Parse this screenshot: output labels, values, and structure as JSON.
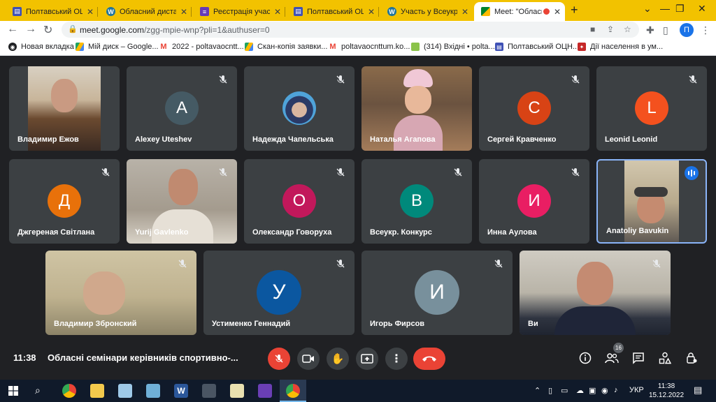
{
  "browser": {
    "tabs": [
      {
        "title": "Полтавський ОЦН",
        "active": false
      },
      {
        "title": "Обласний дистанц",
        "active": false
      },
      {
        "title": "Реєстрація учасни",
        "active": false
      },
      {
        "title": "Полтавський ОЦН",
        "active": false
      },
      {
        "title": "Участь у Всеукраїн",
        "active": false
      },
      {
        "title": "Meet: \"Обласн",
        "active": true
      }
    ],
    "new_tab": "+",
    "url_host": "meet.google.com",
    "url_path": "/zgg-mpie-wnp?pli=1&authuser=0",
    "profile_initial": "П",
    "bookmarks": [
      "Новая вкладка",
      "Мій диск – Google...",
      "2022 - poltavaocntt...",
      "Скан-копія заявки...",
      "poltavaocnttum.ko...",
      "(314) Вхідні • polta...",
      "Полтавський ОЦН...",
      "Дії населення в ум..."
    ]
  },
  "participants": [
    {
      "name": "Владимир Ежов",
      "type": "video",
      "muted": false
    },
    {
      "name": "Alexey Uteshev",
      "type": "avatar",
      "initial": "A",
      "color": "#455a64",
      "muted": true
    },
    {
      "name": "Надежда Чапельська",
      "type": "photo-avatar",
      "muted": true
    },
    {
      "name": "Наталья Агапова",
      "type": "video",
      "muted": false
    },
    {
      "name": "Сергей Кравченко",
      "type": "avatar",
      "initial": "C",
      "color": "#d84315",
      "muted": true
    },
    {
      "name": "Leonid Leonid",
      "type": "avatar",
      "initial": "L",
      "color": "#f4511e",
      "muted": true
    },
    {
      "name": "Джгереная Світлана",
      "type": "avatar",
      "initial": "Д",
      "color": "#e8710a",
      "muted": true
    },
    {
      "name": "Yurij Gavlenko",
      "type": "video",
      "muted": true
    },
    {
      "name": "Олександр Говоруха",
      "type": "avatar",
      "initial": "О",
      "color": "#c2185b",
      "muted": true
    },
    {
      "name": "Всеукр. Конкурс",
      "type": "avatar",
      "initial": "В",
      "color": "#00897b",
      "muted": true
    },
    {
      "name": "Инна Аулова",
      "type": "avatar",
      "initial": "И",
      "color": "#e91e63",
      "muted": true
    },
    {
      "name": "Anatoliy Bavukin",
      "type": "video",
      "muted": false,
      "speaking": true
    },
    {
      "name": "Владимир Збронский",
      "type": "video",
      "muted": true
    },
    {
      "name": "Устименко Геннадий",
      "type": "avatar",
      "initial": "У",
      "color": "#0b57a0",
      "muted": true
    },
    {
      "name": "Игорь Фирсов",
      "type": "avatar",
      "initial": "И",
      "color": "#78909c",
      "muted": true
    },
    {
      "name": "Ви",
      "type": "video",
      "muted": true
    }
  ],
  "meeting": {
    "time": "11:38",
    "title": "Обласні семінари керівників спортивно-...",
    "participant_count": "16"
  },
  "taskbar": {
    "lang": "УКР",
    "time": "11:38",
    "date": "15.12.2022"
  },
  "colors": {
    "tab_bar": "#f2c200",
    "meet_bg": "#202124",
    "tile_bg": "#3c4043",
    "hangup": "#ea4335",
    "speaking": "#1a73e8"
  }
}
